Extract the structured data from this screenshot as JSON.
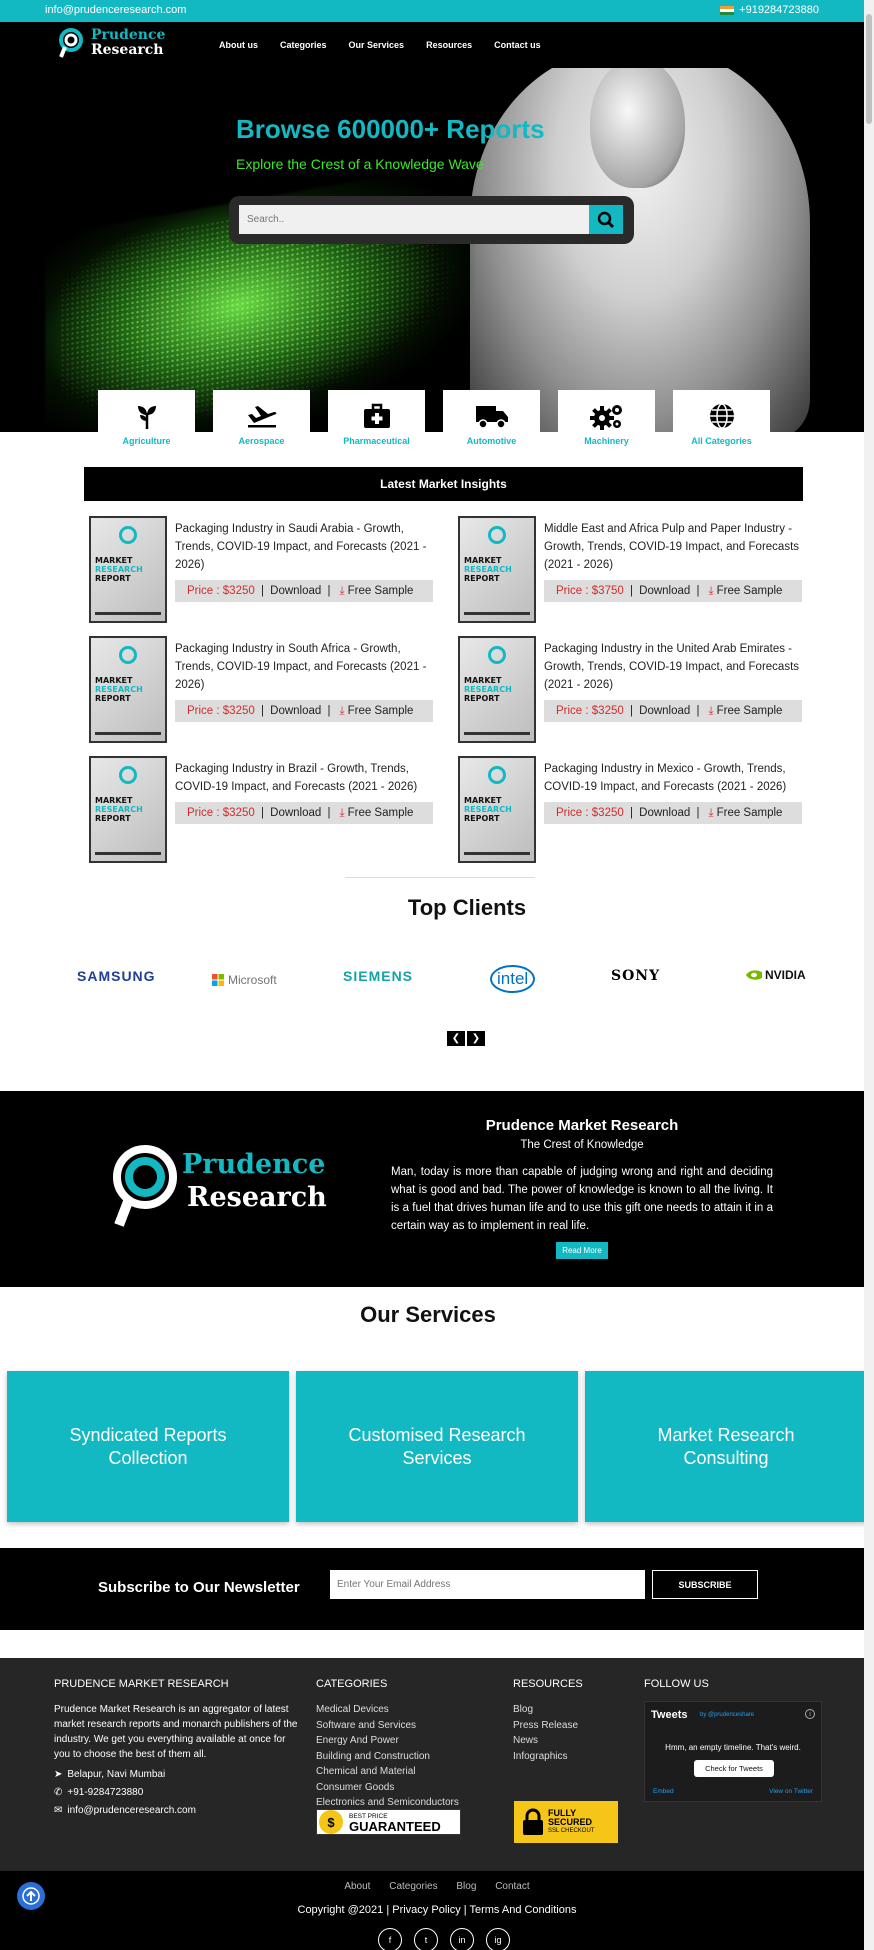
{
  "topbar": {
    "email": "info@prudenceresearch.com",
    "phone": "+919284723880"
  },
  "logo": {
    "line1": "Prudence",
    "line2": "Research"
  },
  "nav": [
    "About us",
    "Categories",
    "Our Services",
    "Resources",
    "Contact us"
  ],
  "hero": {
    "title": "Browse 600000+ Reports",
    "subtitle": "Explore the Crest of a Knowledge Wave",
    "search_placeholder": "Search.."
  },
  "categories": [
    {
      "label": "Agriculture",
      "icon": "plant-icon"
    },
    {
      "label": "Aerospace",
      "icon": "plane-icon"
    },
    {
      "label": "Pharmaceutical",
      "icon": "medkit-icon"
    },
    {
      "label": "Automotive",
      "icon": "truck-icon"
    },
    {
      "label": "Machinery",
      "icon": "gears-icon"
    },
    {
      "label": "All Categories",
      "icon": "globe-icon"
    }
  ],
  "insights": {
    "heading": "Latest Market Insights",
    "cover": {
      "line1": "MARKET",
      "line2": "RESEARCH",
      "line3": "REPORT"
    },
    "download_label": "Download",
    "sample_label": "Free Sample",
    "reports": [
      {
        "title": "Packaging Industry in Saudi Arabia - Growth, Trends, COVID-19 Impact, and Forecasts (2021 - 2026)",
        "price": "Price : $3250"
      },
      {
        "title": "Middle East and Africa Pulp and Paper Industry - Growth, Trends, COVID-19 Impact, and Forecasts (2021 - 2026)",
        "price": "Price : $3750"
      },
      {
        "title": "Packaging Industry in South Africa - Growth, Trends, COVID-19 Impact, and Forecasts (2021 - 2026)",
        "price": "Price : $3250"
      },
      {
        "title": "Packaging Industry in the United Arab Emirates - Growth, Trends, COVID-19 Impact, and Forecasts (2021 - 2026)",
        "price": "Price : $3250"
      },
      {
        "title": "Packaging Industry in Brazil - Growth, Trends, COVID-19 Impact, and Forecasts (2021 - 2026)",
        "price": "Price : $3250"
      },
      {
        "title": "Packaging Industry in Mexico - Growth, Trends, COVID-19 Impact, and Forecasts (2021 - 2026)",
        "price": "Price : $3250"
      }
    ]
  },
  "clients": {
    "heading": "Top Clients",
    "logos": [
      "SAMSUNG",
      "Microsoft",
      "SIEMENS",
      "intel",
      "SONY",
      "NVIDIA"
    ]
  },
  "about": {
    "logo_line1": "Prudence",
    "logo_line2": "Research",
    "heading": "Prudence Market Research",
    "tagline": "The Crest of Knowledge",
    "paragraph": "Man, today is more than capable of judging wrong and right and deciding what is good and bad. The power of knowledge is known to all the living. It is a fuel that drives human life and to use this gift one needs to attain it in a certain way as to implement in real life.",
    "button": "Read More"
  },
  "services": {
    "heading": "Our Services",
    "items": [
      "Syndicated Reports Collection",
      "Customised Research Services",
      "Market Research Consulting"
    ]
  },
  "newsletter": {
    "heading": "Subscribe to Our Newsletter",
    "placeholder": "Enter Your Email Address",
    "button": "SUBSCRIBE"
  },
  "footer": {
    "col1": {
      "heading": "PRUDENCE MARKET RESEARCH",
      "text": "Prudence Market Research is an aggregator of latest market research reports and monarch publishers of the industry. We get you everything available at once for you to choose the best of them all.",
      "address": "Belapur, Navi Mumbai",
      "phone": "+91-9284723880",
      "email": "info@prudenceresearch.com"
    },
    "col2": {
      "heading": "CATEGORIES",
      "links": [
        "Medical Devices",
        "Software and Services",
        "Energy And Power",
        "Building and Construction",
        "Chemical and Material",
        "Consumer Goods",
        "Electronics and Semiconductors"
      ]
    },
    "col3": {
      "heading": "RESOURCES",
      "links": [
        "Blog",
        "Press Release",
        "News",
        "Infographics"
      ]
    },
    "col4": {
      "heading": "FOLLOW US"
    },
    "twitter": {
      "title": "Tweets",
      "by": "by @prudenceshare",
      "empty": "Hmm, an empty timeline. That's weird.",
      "button": "Check for Tweets",
      "embed": "Embed",
      "view": "View on Twitter"
    },
    "badge_price": {
      "small": "BEST PRICE",
      "big": "GUARANTEED"
    },
    "badge_ssl": {
      "line1": "FULLY",
      "line2": "SECURED",
      "line3": "SSL CHECKOUT"
    }
  },
  "bottom": {
    "links": [
      "About",
      "Categories",
      "Blog",
      "Contact"
    ],
    "copyright": "Copyright @2021 | Privacy Policy | Terms And Conditions",
    "social": [
      "f",
      "t",
      "in",
      "ig"
    ]
  },
  "colors": {
    "accent": "#13b9c2",
    "hero_subtitle": "#3ce82a",
    "price": "#d12d2d"
  }
}
